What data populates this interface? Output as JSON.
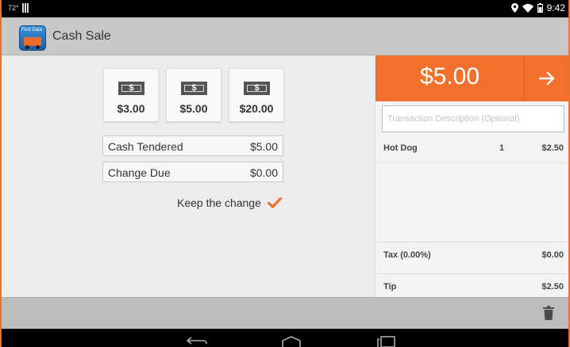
{
  "status_bar": {
    "temperature": "72°",
    "time": "9:42",
    "icons": [
      "location-icon",
      "wifi-icon",
      "battery-icon"
    ]
  },
  "action_bar": {
    "app_icon_text": "First Data",
    "title": "Cash Sale"
  },
  "quick_cash": [
    {
      "label": "$3.00"
    },
    {
      "label": "$5.00"
    },
    {
      "label": "$20.00"
    }
  ],
  "bill_symbol": "$",
  "cash_tendered": {
    "label": "Cash Tendered",
    "value": "$5.00"
  },
  "change_due": {
    "label": "Change Due",
    "value": "$0.00"
  },
  "keep_change": {
    "label": "Keep the change",
    "checked": true
  },
  "order": {
    "total": "$5.00",
    "description_placeholder": "Transaction Description (Optional)",
    "items": [
      {
        "name": "Hot Dog",
        "qty": "1",
        "price": "$2.50"
      }
    ],
    "tax": {
      "label": "Tax (0.00%)",
      "value": "$0.00"
    },
    "tip": {
      "label": "Tip",
      "value": "$2.50"
    }
  },
  "colors": {
    "accent": "#f26f2c",
    "check": "#f26f2c",
    "panel": "#ececec"
  }
}
